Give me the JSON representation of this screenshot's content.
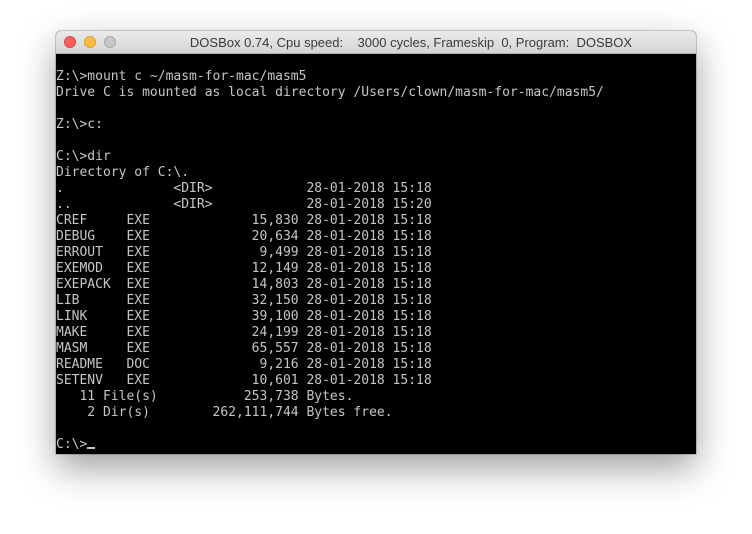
{
  "window": {
    "title": "DOSBox 0.74, Cpu speed:    3000 cycles, Frameskip  0, Program:  DOSBOX"
  },
  "terminal": {
    "lines": [
      "Z:\\>mount c ~/masm-for-mac/masm5",
      "Drive C is mounted as local directory /Users/clown/masm-for-mac/masm5/",
      "",
      "Z:\\>c:",
      "",
      "C:\\>dir",
      "Directory of C:\\.",
      ".              <DIR>            28-01-2018 15:18",
      "..             <DIR>            28-01-2018 15:20",
      "CREF     EXE             15,830 28-01-2018 15:18",
      "DEBUG    EXE             20,634 28-01-2018 15:18",
      "ERROUT   EXE              9,499 28-01-2018 15:18",
      "EXEMOD   EXE             12,149 28-01-2018 15:18",
      "EXEPACK  EXE             14,803 28-01-2018 15:18",
      "LIB      EXE             32,150 28-01-2018 15:18",
      "LINK     EXE             39,100 28-01-2018 15:18",
      "MAKE     EXE             24,199 28-01-2018 15:18",
      "MASM     EXE             65,557 28-01-2018 15:18",
      "README   DOC              9,216 28-01-2018 15:18",
      "SETENV   EXE             10,601 28-01-2018 15:18",
      "   11 File(s)           253,738 Bytes.",
      "    2 Dir(s)        262,111,744 Bytes free.",
      ""
    ],
    "prompt": "C:\\>"
  },
  "colors": {
    "terminal_bg": "#000000",
    "terminal_fg": "#c6c6c6",
    "close": "#fc605c",
    "minimize": "#fdbc40",
    "zoom_inactive": "#c8c8c8"
  }
}
